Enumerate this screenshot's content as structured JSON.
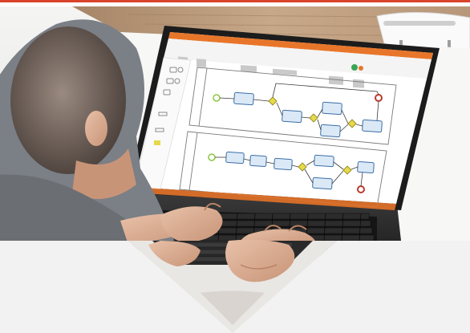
{
  "photo": {
    "subject": "person-using-laptop-with-bpmn-diagram-software",
    "colors": {
      "accent_orange": "#e8762a",
      "top_bar_red": "#d9442b",
      "desk_wood": "#b89777",
      "background_light": "#f2f2f2",
      "laptop_dark": "#2b2b2b",
      "screen_bg": "#ffffff",
      "diagram_node_fill": "#dbe9f7",
      "diagram_node_stroke": "#3b6ea5",
      "gateway_yellow": "#e6d94a",
      "start_event_green": "#8cc63f",
      "end_event_red": "#c0392b"
    }
  }
}
